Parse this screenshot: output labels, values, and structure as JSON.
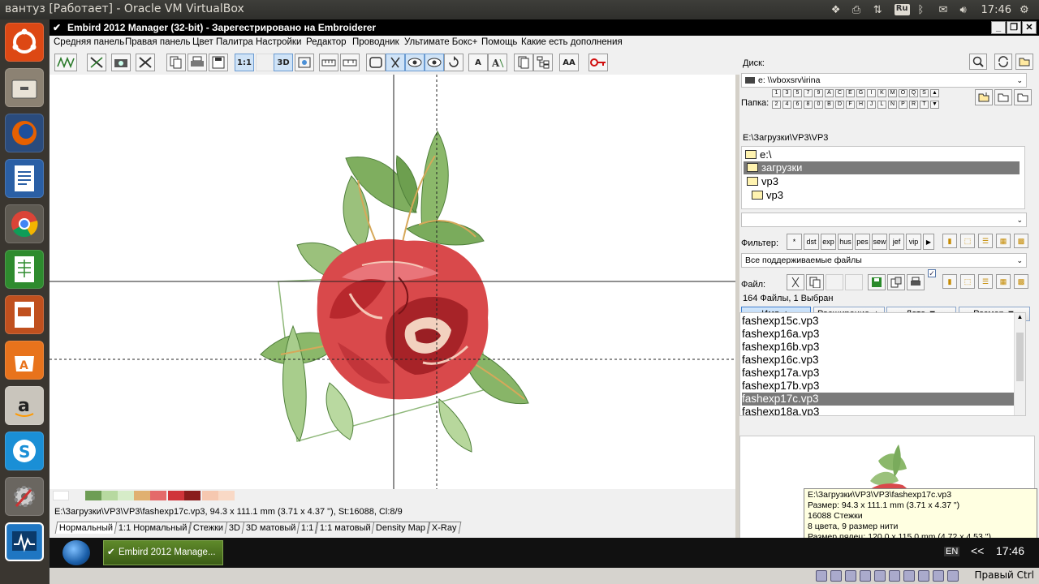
{
  "desktop": {
    "title": "вантуз [Работает] - Oracle VM VirtualBox",
    "tray": {
      "lang": "Ru",
      "time": "17:46"
    }
  },
  "launcher": {
    "items": [
      "ubuntu-logo",
      "files",
      "firefox",
      "writer",
      "chrome",
      "calc",
      "impress",
      "software-center",
      "amazon",
      "skype",
      "settings",
      "system-monitor"
    ]
  },
  "window": {
    "title": "Embird 2012 Manager (32-bit) - Зарегестрировано на Embroiderer",
    "menu": [
      "Средняя панель",
      "Правая панель",
      "Цвет Палитра",
      "Настройки",
      "Редактор",
      "Проводник",
      "Ультимате Бокс+",
      "Помощь",
      "Какие есть дополнения"
    ]
  },
  "toolbar": {
    "one_to_one": "1:1",
    "three_d": "3D",
    "text_a": "A",
    "text_aa": "AA"
  },
  "status": {
    "path_info": "E:\\Загрузки\\VP3\\VP3\\fashexp17c.vp3, 94.3 x 111.1 mm (3.71 x 4.37 \"), St:16088, Cl:8/9",
    "swatches": [
      "#ffffff",
      "#6e9d55",
      "#b7d9a0",
      "#d6ecc8",
      "#e0b070",
      "#e46a6a",
      "#d0343a",
      "#8a1c1c",
      "#f6c8b0",
      "#f9d9c6"
    ],
    "view_tabs": [
      "Нормальный",
      "1:1 Нормальный",
      "Стежки",
      "3D",
      "3D матовый",
      "1:1",
      "1:1 матовый",
      "Density Map",
      "X-Ray"
    ]
  },
  "right": {
    "disk_label": "Диск:",
    "disk_value": "e: \\\\vboxsrv\\irina",
    "folder_label": "Папка:",
    "letters_row1": [
      "1",
      "3",
      "5",
      "7",
      "9",
      "A",
      "C",
      "E",
      "G",
      "I",
      "K",
      "M",
      "O",
      "Q",
      "S"
    ],
    "letters_row2": [
      "2",
      "4",
      "6",
      "8",
      "0",
      "B",
      "D",
      "F",
      "H",
      "J",
      "L",
      "N",
      "P",
      "R",
      "T"
    ],
    "current_path": "E:\\Загрузки\\VP3\\VP3",
    "tree": [
      "e:\\",
      "загрузки",
      "vp3",
      "vp3"
    ],
    "filter_label": "Фильтер:",
    "filter_buttons": [
      "*",
      "dst",
      "exp",
      "hus",
      "pes",
      "sew",
      "jef",
      "vip"
    ],
    "filter_value": "Все поддерживаемые файлы",
    "file_label": "Файл:",
    "count_text": "164 Файлы, 1 Выбран",
    "columns": [
      "Имя",
      "Расширение",
      "Дата",
      "Размер"
    ],
    "files": [
      "fashexp15c.vp3",
      "fashexp16a.vp3",
      "fashexp16b.vp3",
      "fashexp16c.vp3",
      "fashexp17a.vp3",
      "fashexp17b.vp3",
      "fashexp17c.vp3",
      "fashexp18a.vp3"
    ],
    "selected_file": "fashexp17c.vp3"
  },
  "tooltip": {
    "line1": "E:\\Загрузки\\VP3\\VP3\\fashexp17c.vp3",
    "line2": "Размер: 94.3 x 111.1 mm (3.71 x 4.37 \")",
    "line3": "16088 Стежки",
    "line4": "8 цвета, 9 размер нити",
    "line5": "Размер пялец: 120.0 x 115.0 mm (4.72 x 4.53 \")"
  },
  "taskbar": {
    "item": "Embird 2012 Manage...",
    "lang": "EN",
    "arrows": "<<",
    "time": "17:46"
  },
  "vbox": {
    "hostkey": "Правый Ctrl"
  }
}
